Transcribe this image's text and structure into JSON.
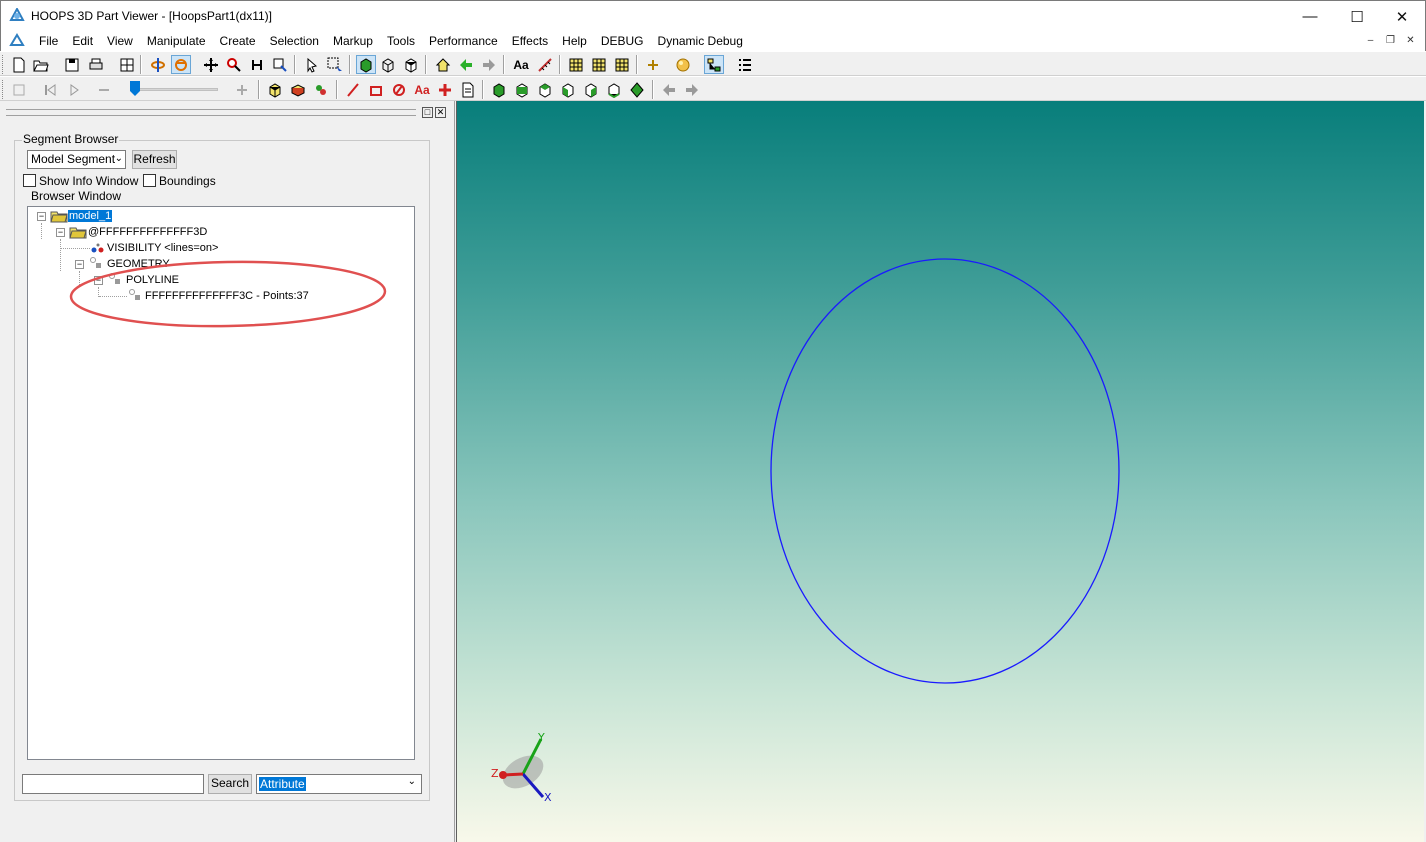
{
  "window": {
    "title": "HOOPS 3D Part Viewer - [HoopsPart1(dx11)]",
    "controls": {
      "minimize": "—",
      "maximize": "☐",
      "close": "✕"
    }
  },
  "menu": {
    "items": [
      "File",
      "Edit",
      "View",
      "Manipulate",
      "Create",
      "Selection",
      "Markup",
      "Tools",
      "Performance",
      "Effects",
      "Help",
      "DEBUG",
      "Dynamic Debug"
    ],
    "mdi_controls": {
      "minimize": "–",
      "restore": "❐",
      "close": "✕"
    }
  },
  "panel": {
    "controls": {
      "float": "□",
      "close": "✕"
    },
    "segment_browser_label": "Segment Browser",
    "segment_select_value": "Model Segment",
    "refresh_label": "Refresh",
    "show_info_label": "Show Info Window",
    "boundings_label": "Boundings",
    "browser_window_label": "Browser Window",
    "tree": {
      "root": "model_1",
      "child": "@FFFFFFFFFFFFFF3D",
      "visibility": "VISIBILITY <lines=on>",
      "geometry": "GEOMETRY",
      "polyline": "POLYLINE",
      "polyline_item": "FFFFFFFFFFFFFF3C - Points:37"
    },
    "search_input_value": "",
    "search_button_label": "Search",
    "attribute_select_value": "Attribute"
  },
  "axis_triad": {
    "x": "X",
    "y": "Y",
    "z": "Z"
  },
  "colors": {
    "circle": "#0000ff",
    "annotation_ring": "#e05050",
    "selection": "#0078d7"
  }
}
